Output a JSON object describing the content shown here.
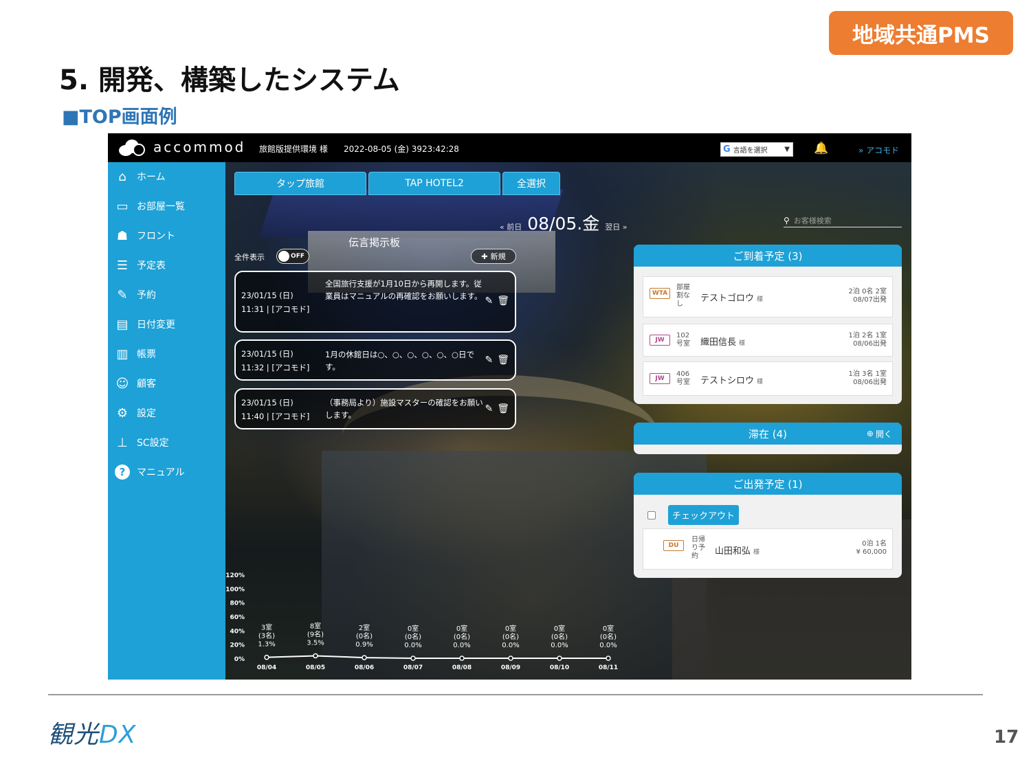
{
  "slide": {
    "badge": "地域共通PMS",
    "title": "5. 開発、構築したシステム",
    "subtitle": "■TOP画面例",
    "footer_logo_a": "観光",
    "footer_logo_b": "DX",
    "page_number": "17"
  },
  "app": {
    "logo_text": "accommod",
    "facility": "旅館版提供環境 様",
    "datetime": "2022-08-05 (金) 3923:42:28",
    "language_select": "言語を選択",
    "account_link": "» アコモド",
    "sidebar": [
      {
        "label": "ホーム",
        "icon": "home-icon"
      },
      {
        "label": "お部屋一覧",
        "icon": "bed-icon"
      },
      {
        "label": "フロント",
        "icon": "front-desk-icon"
      },
      {
        "label": "予定表",
        "icon": "schedule-icon"
      },
      {
        "label": "予約",
        "icon": "booking-icon"
      },
      {
        "label": "日付変更",
        "icon": "date-change-icon"
      },
      {
        "label": "帳票",
        "icon": "report-icon"
      },
      {
        "label": "顧客",
        "icon": "customer-icon"
      },
      {
        "label": "設定",
        "icon": "gear-icon"
      },
      {
        "label": "SC設定",
        "icon": "antenna-icon"
      },
      {
        "label": "マニュアル",
        "icon": "help-icon"
      }
    ],
    "tabs": [
      "タップ旅館",
      "TAP HOTEL2",
      "全選択"
    ],
    "date_nav": {
      "prev": "« 前日",
      "date": "08/05.金",
      "next": "翌日 »"
    },
    "search_placeholder": "お客様検索",
    "board": {
      "title": "伝言掲示板",
      "show_all": "全件表示",
      "toggle": "OFF",
      "new_button": "新規",
      "messages": [
        {
          "date": "23/01/15 (日)",
          "time": "11:31 | [アコモド]",
          "text": "全国旅行支援が1月10日から再開します。従業員はマニュアルの再確認をお願いします。"
        },
        {
          "date": "23/01/15 (日)",
          "time": "11:32 | [アコモド]",
          "text": "1月の休館日は○、○、○、○、○、○日です。"
        },
        {
          "date": "23/01/15 (日)",
          "time": "11:40 | [アコモド]",
          "text": "（事務局より）施設マスターの確認をお願いします。"
        }
      ]
    },
    "arrivals": {
      "title": "ご到着予定 (3)",
      "guests": [
        {
          "tag": "WTA",
          "room": "部屋割なし",
          "name": "テストゴロウ",
          "honorific": "様",
          "stay": "2泊 0名 2室",
          "depart": "08/07出発"
        },
        {
          "tag": "JW",
          "room": "102号室",
          "name": "織田信長",
          "honorific": "様",
          "stay": "1泊 2名 1室",
          "depart": "08/06出発"
        },
        {
          "tag": "JW",
          "room": "406号室",
          "name": "テストシロウ",
          "honorific": "様",
          "stay": "1泊 3名 1室",
          "depart": "08/06出発"
        }
      ]
    },
    "staying": {
      "title": "滞在 (4)",
      "open": "開く"
    },
    "departures": {
      "title": "ご出発予定 (1)",
      "checkout_button": "チェックアウト",
      "guests": [
        {
          "tag": "DU",
          "room": "日帰り予約",
          "name": "山田和弘",
          "honorific": "様",
          "stay": "0泊 1名",
          "price": "¥ 60,000"
        }
      ]
    },
    "colors": {
      "accent": "#1ea1d6",
      "badge": "#ed7d31",
      "topbar": "#000000"
    }
  },
  "chart_data": {
    "type": "line",
    "x": [
      "08/04",
      "08/05",
      "08/06",
      "08/07",
      "08/08",
      "08/09",
      "08/10",
      "08/11"
    ],
    "series": [
      {
        "values": [
          1.3,
          3.5,
          0.9,
          0.0,
          0.0,
          0.0,
          0.0,
          0.0
        ]
      }
    ],
    "point_labels": [
      [
        "3室",
        "(3名)",
        "1.3%"
      ],
      [
        "8室",
        "(9名)",
        "3.5%"
      ],
      [
        "2室",
        "(0名)",
        "0.9%"
      ],
      [
        "0室",
        "(0名)",
        "0.0%"
      ],
      [
        "0室",
        "(0名)",
        "0.0%"
      ],
      [
        "0室",
        "(0名)",
        "0.0%"
      ],
      [
        "0室",
        "(0名)",
        "0.0%"
      ],
      [
        "0室",
        "(0名)",
        "0.0%"
      ]
    ],
    "yticks": [
      "0%",
      "20%",
      "40%",
      "60%",
      "80%",
      "100%",
      "120%"
    ],
    "ylim": [
      0,
      120
    ],
    "unit": "%"
  }
}
